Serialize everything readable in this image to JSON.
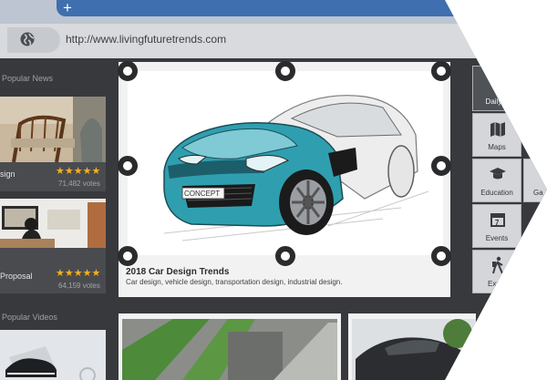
{
  "browser": {
    "new_tab_label": "+",
    "url": "http://www.livingfuturetrends.com"
  },
  "sidebar": {
    "popular_news_title": "Popular News",
    "popular_videos_title": "Popular Videos",
    "news": [
      {
        "label": "sign",
        "rating": "★★★★★",
        "votes": "71,482 votes"
      },
      {
        "label": "Proposal",
        "rating": "★★★★★",
        "votes": "64,159 votes"
      }
    ]
  },
  "feature": {
    "title": "2018 Car Design Trends",
    "subtitle": "Car design, vehicle design, transportation design, industrial design.",
    "plate_text": "CONCEPT"
  },
  "right_tiles": [
    {
      "label": "Daily F",
      "icon": "daily-icon"
    },
    {
      "label": "Maps",
      "icon": "map-icon"
    },
    {
      "label": "Education",
      "icon": "graduation-cap-icon"
    },
    {
      "label": "Ga",
      "icon": "games-icon"
    },
    {
      "label": "Events",
      "icon": "calendar-icon"
    },
    {
      "label": "Explo",
      "icon": "hiker-icon"
    }
  ],
  "colors": {
    "tab": "#3f6fae",
    "star": "#f2b01e",
    "content_bg": "#38393c",
    "car_body": "#2f9fb0"
  }
}
